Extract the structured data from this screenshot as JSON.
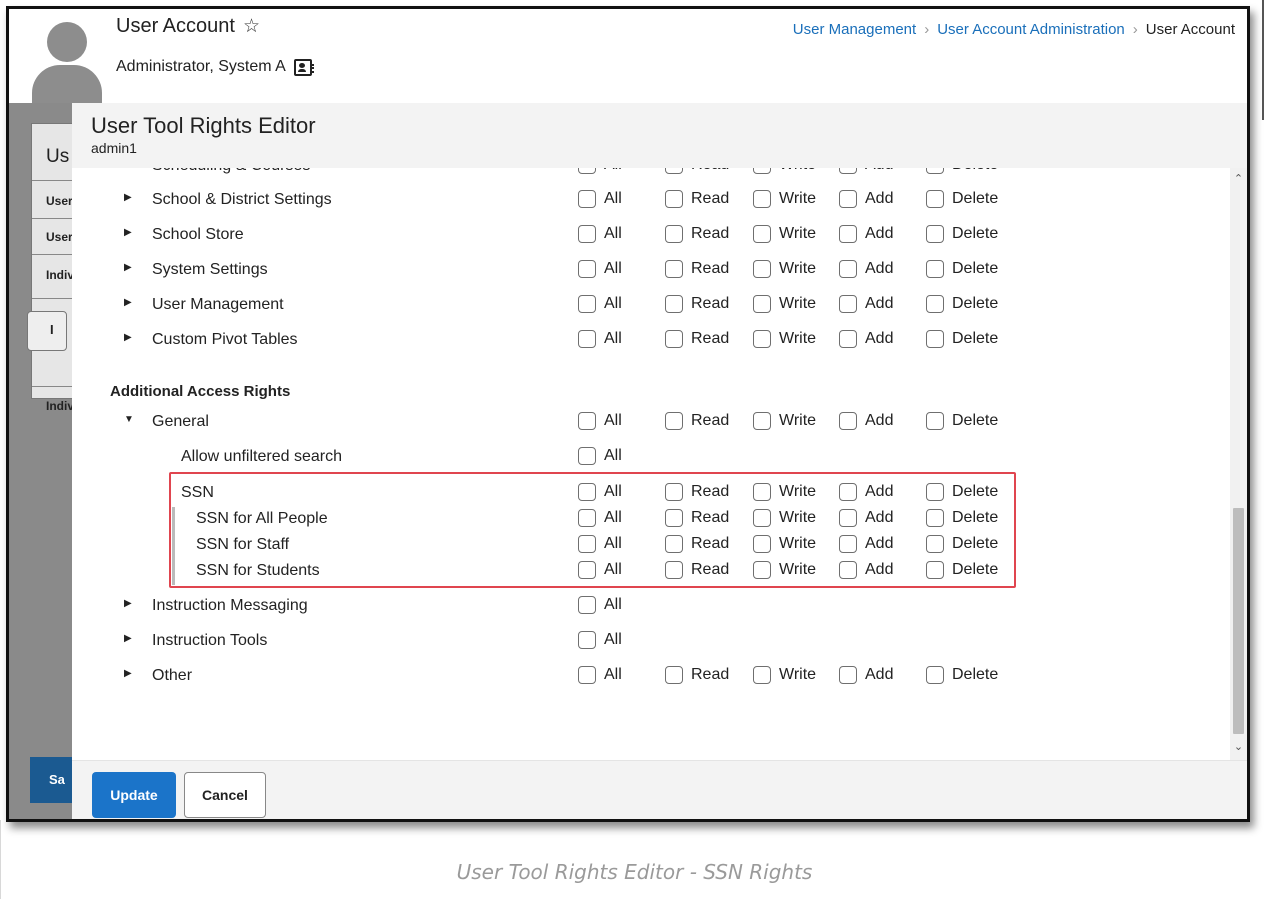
{
  "header": {
    "title": "User Account",
    "person_name": "Administrator, System A",
    "breadcrumb": [
      "User Management",
      "User Account Administration",
      "User Account"
    ]
  },
  "background": {
    "panel_heading": "Us",
    "rows": [
      "User",
      "User",
      "Indiv",
      "Indiv"
    ],
    "save_label": "Save"
  },
  "modal": {
    "title": "User Tool Rights Editor",
    "subtitle": "admin1",
    "partial_top_label": "Scheduling & Courses",
    "section_label": "Additional Access Rights",
    "rights": [
      "All",
      "Read",
      "Write",
      "Add",
      "Delete"
    ],
    "top_rows": [
      {
        "label": "School & District Settings"
      },
      {
        "label": "School Store"
      },
      {
        "label": "System Settings"
      },
      {
        "label": "User Management"
      },
      {
        "label": "Custom Pivot Tables"
      }
    ],
    "general_label": "General",
    "allow_unfiltered_label": "Allow unfiltered search",
    "ssn_label": "SSN",
    "ssn_children": [
      "SSN for All People",
      "SSN for Staff",
      "SSN for Students"
    ],
    "bottom_rows": [
      {
        "label": "Instruction Messaging",
        "all_only": true
      },
      {
        "label": "Instruction Tools",
        "all_only": true
      },
      {
        "label": "Other",
        "all_only": false
      }
    ],
    "update_label": "Update",
    "cancel_label": "Cancel"
  },
  "caption": "User Tool Rights Editor - SSN Rights",
  "colors": {
    "link": "#1a6fba",
    "update_button": "#1b74c9",
    "highlight_box": "#e0454f",
    "overlay": "#8a8a8a"
  }
}
